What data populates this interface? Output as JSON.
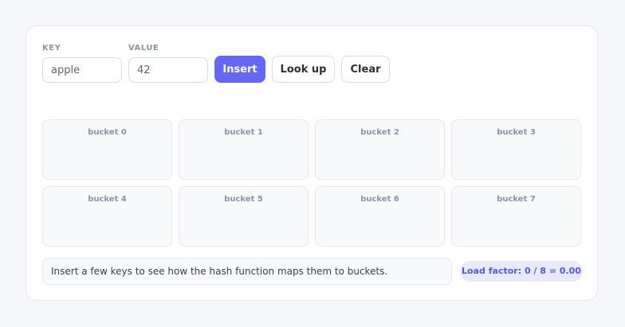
{
  "form": {
    "key_label": "KEY",
    "key_value": "apple",
    "value_label": "VALUE",
    "value_value": "42"
  },
  "buttons": {
    "insert": "Insert",
    "lookup": "Look up",
    "clear": "Clear"
  },
  "buckets": [
    {
      "label": "bucket 0"
    },
    {
      "label": "bucket 1"
    },
    {
      "label": "bucket 2"
    },
    {
      "label": "bucket 3"
    },
    {
      "label": "bucket 4"
    },
    {
      "label": "bucket 5"
    },
    {
      "label": "bucket 6"
    },
    {
      "label": "bucket 7"
    }
  ],
  "status": {
    "hint": "Insert a few keys to see how the hash function maps them to buckets.",
    "load_factor": "Load factor: 0 / 8 = 0.00"
  },
  "colors": {
    "accent": "#6467f2",
    "badge_bg": "#e8eafc",
    "badge_text": "#5457e0"
  }
}
